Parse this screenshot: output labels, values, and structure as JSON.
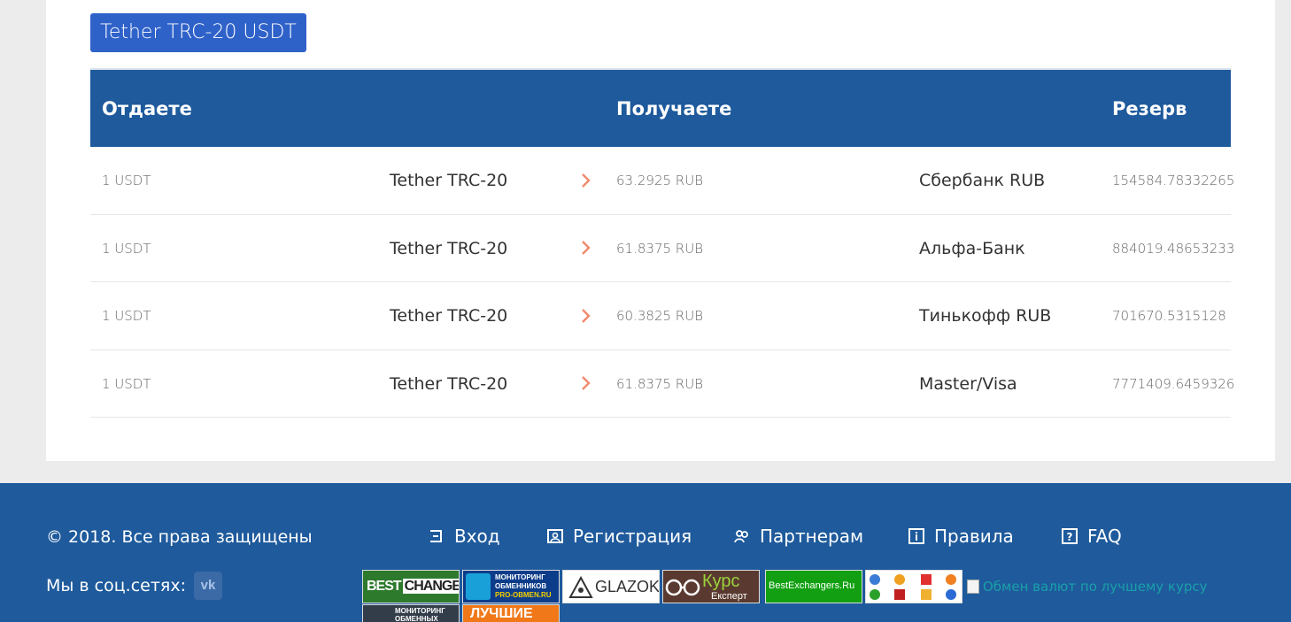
{
  "pair": {
    "title": "Tether TRC-20 USDT"
  },
  "table": {
    "headers": {
      "give": "Отдаете",
      "get": "Получаете",
      "reserve": "Резерв"
    },
    "rows": [
      {
        "amount": "1 USDT",
        "from": "Tether TRC-20",
        "rate": "63.2925 RUB",
        "to": "Сбербанк RUB",
        "reserve": "154584.78332265"
      },
      {
        "amount": "1 USDT",
        "from": "Tether TRC-20",
        "rate": "61.8375 RUB",
        "to": "Альфа-Банк",
        "reserve": "884019.48653233"
      },
      {
        "amount": "1 USDT",
        "from": "Tether TRC-20",
        "rate": "60.3825 RUB",
        "to": "Тинькофф RUB",
        "reserve": "701670.5315128"
      },
      {
        "amount": "1 USDT",
        "from": "Tether TRC-20",
        "rate": "61.8375 RUB",
        "to": "Master/Visa",
        "reserve": "7771409.6459326"
      }
    ]
  },
  "footer": {
    "copyright": "© 2018. Все права защищены",
    "social_label": "Мы в соц.сетях:",
    "vk": "vk",
    "menu": {
      "login": "Вход",
      "register": "Регистрация",
      "partners": "Партнерам",
      "rules": "Правила",
      "faq": "FAQ"
    },
    "badges": {
      "bestchange_a": "BEST",
      "bestchange_b": "CHANGE",
      "proobmen_a": "МОНИТОРИНГ",
      "proobmen_b": "ОБМЕННИКОВ",
      "proobmen_c": "PRO-OBMEN.RU",
      "glazok": "GLAZOK",
      "kurs_a": "Курс",
      "kurs_b": "Експерт",
      "bestexchangers": "BestExchangers.Ru",
      "monitor2_a": "МОНИТОРИНГ",
      "monitor2_b": "ОБМЕННЫХ",
      "best": "ЛУЧШИЕ"
    },
    "broken_image_alt": "Обмен валют по лучшему курсу"
  },
  "colors": {
    "primary": "#1e5a9c",
    "button": "#2f62c9",
    "arrow": "#f08a6c",
    "link": "#1aa0a8"
  }
}
